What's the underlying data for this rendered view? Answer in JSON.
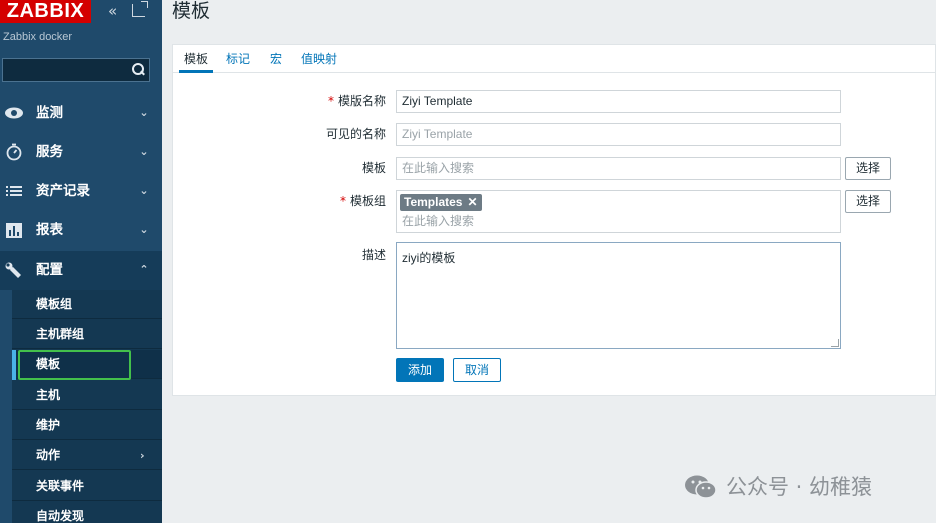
{
  "sidebar": {
    "logo": "ZABBIX",
    "server_name": "Zabbix docker",
    "search": {
      "value": "",
      "placeholder": ""
    },
    "menu": [
      {
        "label": "监测",
        "icon": "eye-icon"
      },
      {
        "label": "服务",
        "icon": "stopwatch-icon"
      },
      {
        "label": "资产记录",
        "icon": "list-icon"
      },
      {
        "label": "报表",
        "icon": "bar-chart-icon"
      },
      {
        "label": "配置",
        "icon": "wrench-icon"
      }
    ],
    "submenu": [
      {
        "label": "模板组"
      },
      {
        "label": "主机群组"
      },
      {
        "label": "模板"
      },
      {
        "label": "主机"
      },
      {
        "label": "维护"
      },
      {
        "label": "动作"
      },
      {
        "label": "关联事件"
      },
      {
        "label": "自动发现"
      }
    ]
  },
  "page": {
    "title": "模板",
    "tabs": [
      {
        "label": "模板"
      },
      {
        "label": "标记"
      },
      {
        "label": "宏"
      },
      {
        "label": "值映射"
      }
    ],
    "form": {
      "template_name": {
        "label": "模版名称",
        "value": "Ziyi Template"
      },
      "visible_name": {
        "label": "可见的名称",
        "placeholder": "Ziyi Template"
      },
      "templates": {
        "label": "模板",
        "placeholder": "在此输入搜索",
        "select_label": "选择"
      },
      "template_groups": {
        "label": "模板组",
        "tag": "Templates",
        "tag_remove": "✕",
        "placeholder": "在此输入搜索",
        "select_label": "选择"
      },
      "description": {
        "label": "描述",
        "value": "ziyi的模板"
      },
      "required_mark": "*",
      "add_label": "添加",
      "cancel_label": "取消"
    }
  },
  "watermark": {
    "text": "公众号 · 幼稚猿"
  },
  "colors": {
    "sidebar_bg": "#1f4a6b",
    "logo_bg": "#d40000",
    "accent": "#0275b8",
    "highlight": "#43c04b"
  }
}
